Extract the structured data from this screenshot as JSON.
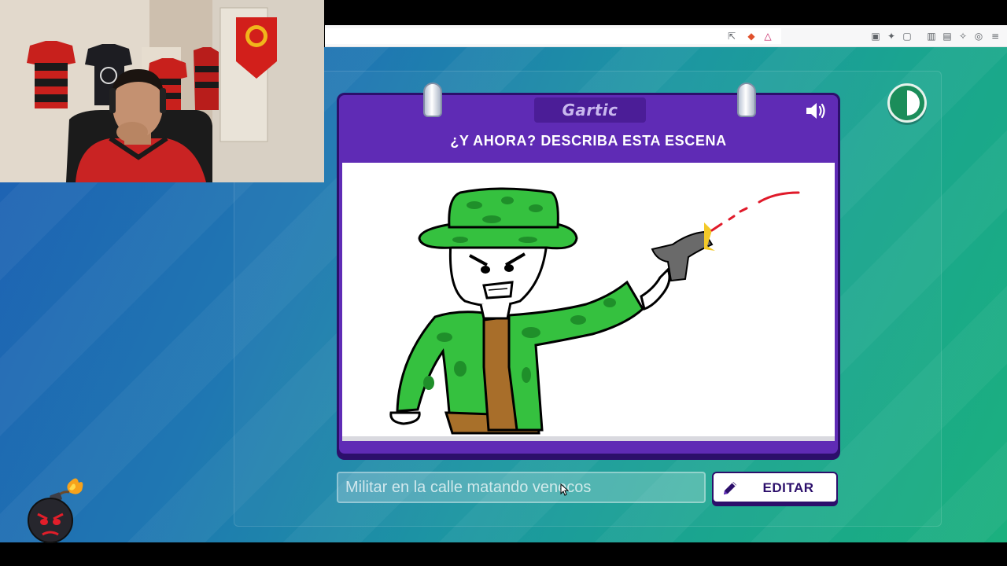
{
  "game": {
    "logo_text": "Gartic",
    "card_title": "¿Y AHORA? DESCRIBA ESTA ESCENA",
    "guess_input_value": "Militar en la calle matando venecos",
    "edit_button_label": "EDITAR"
  },
  "icons": {
    "speaker": "speaker-icon",
    "pencil": "pencil-icon",
    "toggle": "half-circle-toggle-icon",
    "bomb": "bomb-emoji-icon"
  },
  "colors": {
    "card_purple": "#5f2bb5",
    "card_border": "#2c0f6b",
    "background_start": "#1e5fb3",
    "background_end": "#1bb07e"
  }
}
